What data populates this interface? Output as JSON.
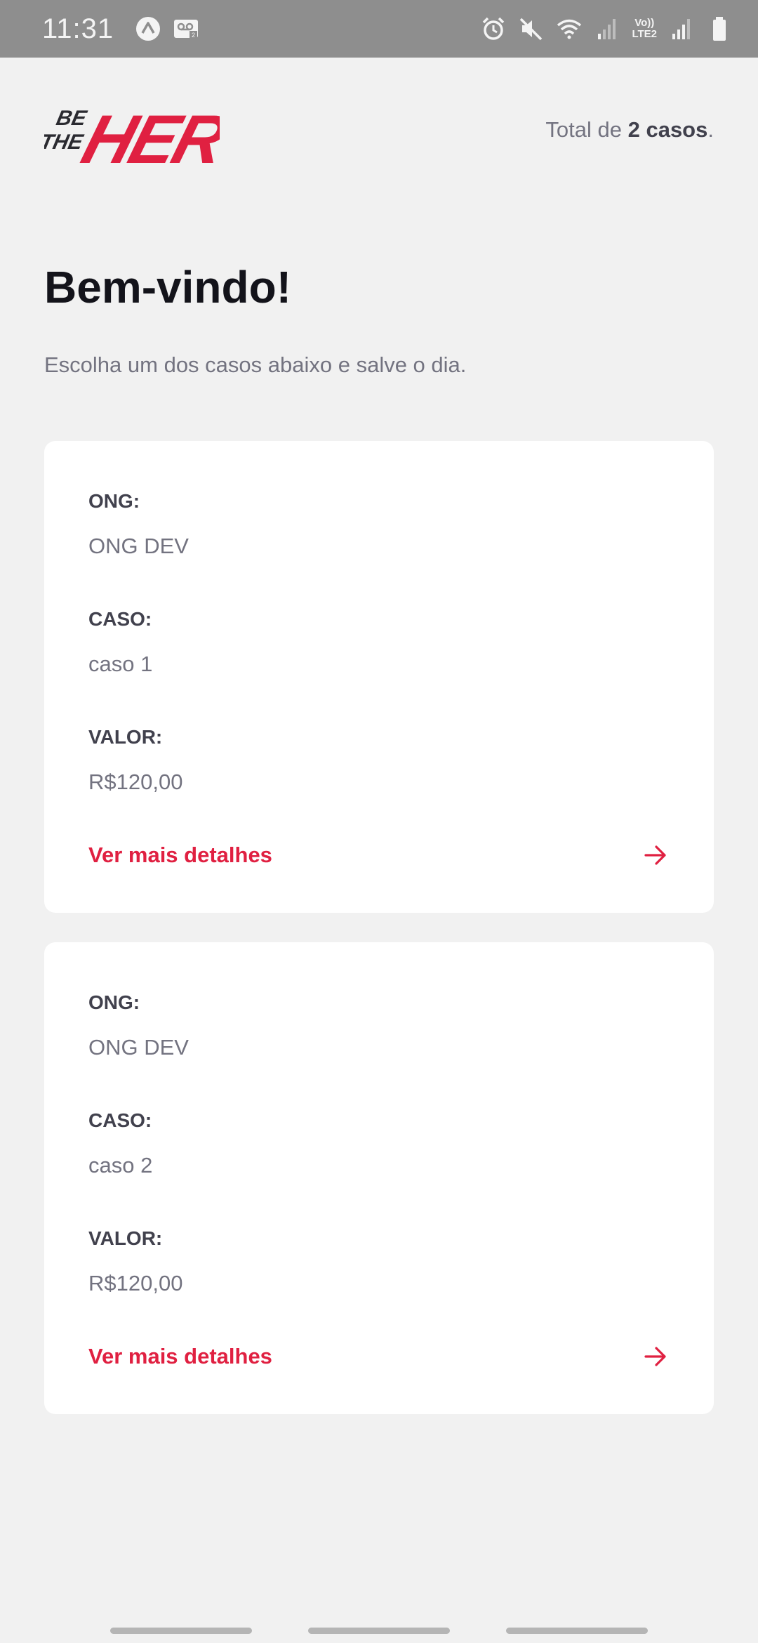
{
  "status_bar": {
    "time": "11:31",
    "lte_label_top": "Vo))",
    "lte_label_bottom": "LTE2",
    "icons": [
      "app-a-icon",
      "voicemail-icon",
      "alarm-icon",
      "mute-icon",
      "wifi-icon",
      "signal-icon",
      "signal-2-icon",
      "battery-icon"
    ]
  },
  "header": {
    "logo_line1": "BE",
    "logo_line2": "THE",
    "logo_main": "HERO",
    "total_prefix": "Total de ",
    "total_count": "2 casos",
    "total_suffix": "."
  },
  "main": {
    "title": "Bem-vindo!",
    "subtitle": "Escolha um dos casos abaixo e salve o dia."
  },
  "labels": {
    "ong": "ONG:",
    "caso": "CASO:",
    "valor": "VALOR:",
    "details": "Ver mais detalhes"
  },
  "incidents": [
    {
      "ong": "ONG DEV",
      "caso": "caso 1",
      "valor": "R$120,00"
    },
    {
      "ong": "ONG DEV",
      "caso": "caso 2",
      "valor": "R$120,00"
    }
  ],
  "colors": {
    "brand": "#e02041",
    "background": "#f1f1f1",
    "title": "#13131a",
    "text": "#737380",
    "label": "#41414d"
  }
}
